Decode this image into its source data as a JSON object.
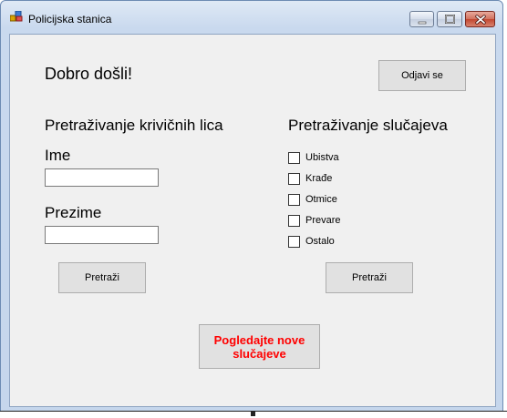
{
  "window": {
    "title": "Policijska stanica"
  },
  "main": {
    "welcome": "Dobro došli!",
    "logout_label": "Odjavi se",
    "persons": {
      "title": "Pretraživanje krivičnih lica",
      "name_label": "Ime",
      "name_value": "",
      "surname_label": "Prezime",
      "surname_value": "",
      "search_label": "Pretraži"
    },
    "cases": {
      "title": "Pretraživanje slučajeva",
      "options": [
        "Ubistva",
        "Krađe",
        "Otmice",
        "Prevare",
        "Ostalo"
      ],
      "search_label": "Pretraži"
    },
    "new_cases_label": "Pogledajte nove\nslučajeve"
  },
  "colors": {
    "highlight_text": "#ff0000",
    "client_bg": "#f0f0f0"
  }
}
